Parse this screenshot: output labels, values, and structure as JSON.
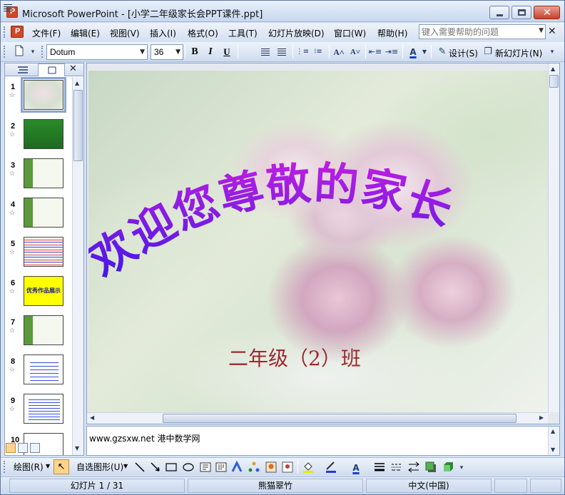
{
  "window": {
    "title": "Microsoft PowerPoint - [小学二年级家长会PPT课件.ppt]"
  },
  "menu": {
    "items": [
      {
        "label": "文件(F)"
      },
      {
        "label": "编辑(E)"
      },
      {
        "label": "视图(V)"
      },
      {
        "label": "插入(I)"
      },
      {
        "label": "格式(O)"
      },
      {
        "label": "工具(T)"
      },
      {
        "label": "幻灯片放映(D)"
      },
      {
        "label": "窗口(W)"
      },
      {
        "label": "帮助(H)"
      }
    ],
    "help_placeholder": "键入需要帮助的问题"
  },
  "toolbar": {
    "font": "Dotum",
    "size": "36",
    "bold": "B",
    "italic": "I",
    "underline": "U",
    "design_label": "设计(S)",
    "new_slide_label": "新幻灯片(N)"
  },
  "thumbnails": [
    {
      "num": "1",
      "star": "☆",
      "selected": true
    },
    {
      "num": "2",
      "star": "☆"
    },
    {
      "num": "3",
      "star": "☆"
    },
    {
      "num": "4",
      "star": "☆"
    },
    {
      "num": "5",
      "star": "☆"
    },
    {
      "num": "6",
      "star": "☆",
      "text": "优秀作品展示"
    },
    {
      "num": "7",
      "star": "☆"
    },
    {
      "num": "8",
      "star": "☆"
    },
    {
      "num": "9",
      "star": "☆"
    },
    {
      "num": "10",
      "star": ""
    }
  ],
  "slide": {
    "title": "欢迎您尊敬的家长",
    "subtitle": "二年级（2）班",
    "title_color_start": "#c21fe0",
    "title_color_end": "#3a17e8"
  },
  "notes": {
    "text": "www.gzsxw.net 港中数学网"
  },
  "drawing_toolbar": {
    "draw_label": "绘图(R)",
    "autoshape_label": "自选图形(U)"
  },
  "status": {
    "slide_info": "幻灯片 1 / 31",
    "design": "熊猫翠竹",
    "language": "中文(中国)"
  }
}
